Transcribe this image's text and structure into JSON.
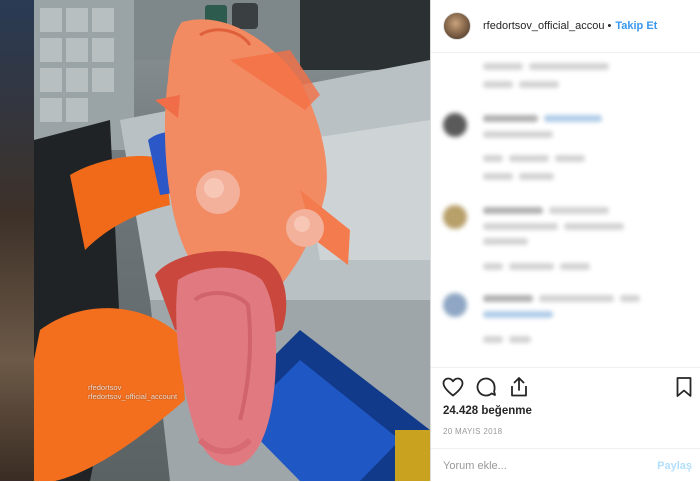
{
  "post": {
    "username": "rfedortsov_official_accou",
    "separator": "•",
    "follow_label": "Takip Et",
    "likes": "24.428 beğenme",
    "date": "20 MAYIS 2018",
    "comment_placeholder": "Yorum ekle...",
    "post_label": "Paylaş"
  },
  "photo": {
    "watermark": [
      "rfedortsov",
      "rfedortsov_official_account"
    ]
  },
  "icons": {
    "like": "heart-icon",
    "comment": "comment-icon",
    "share": "share-icon",
    "save": "bookmark-icon"
  },
  "colors": {
    "follow": "#3897f0",
    "post_button_disabled": "#b2dffc",
    "text": "#262626",
    "muted": "#999999"
  }
}
